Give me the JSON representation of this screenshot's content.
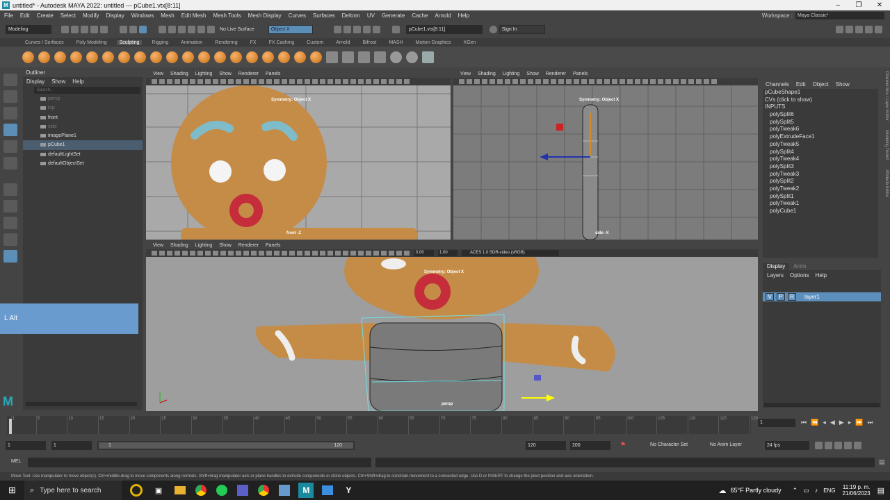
{
  "window": {
    "title": "untitled* - Autodesk MAYA 2022: untitled   ---   pCube1.vtx[8:11]"
  },
  "menu": [
    "File",
    "Edit",
    "Create",
    "Select",
    "Modify",
    "Display",
    "Windows",
    "Mesh",
    "Edit Mesh",
    "Mesh Tools",
    "Mesh Display",
    "Curves",
    "Surfaces",
    "Deform",
    "UV",
    "Generate",
    "Cache",
    "Arnold",
    "Help"
  ],
  "workspace": {
    "label": "Workspace :",
    "value": "Maya Classic*"
  },
  "status": {
    "mode": "Modeling",
    "live": "No Live Surface",
    "symmetry": "Object X",
    "selection": "pCube1.vtx[8:11]",
    "signin": "Sign In"
  },
  "shelf_tabs": [
    "Curves / Surfaces",
    "Poly Modeling",
    "Sculpting",
    "Rigging",
    "Animation",
    "Rendering",
    "FX",
    "FX Caching",
    "Custom",
    "Arnold",
    "Bifrost",
    "MASH",
    "Motion Graphics",
    "XGen"
  ],
  "shelf_active": "Sculpting",
  "outliner": {
    "title": "Outliner",
    "menu": [
      "Display",
      "Show",
      "Help"
    ],
    "search": "Search...",
    "items": [
      "persp",
      "top",
      "front",
      "side",
      "imagePlane1",
      "pCube1",
      "defaultLightSet",
      "defaultObjectSet"
    ]
  },
  "viewports": {
    "menu": [
      "View",
      "Shading",
      "Lighting",
      "Show",
      "Renderer",
      "Panels"
    ],
    "front_hud": "Symmetry: Object X",
    "front_label": "front -Z",
    "side_hud": "Symmetry: Object X",
    "side_label": "side -X",
    "persp_hud": "Symmetry: Object X",
    "persp_label": "persp",
    "exposure": "0.00",
    "gamma": "1.00",
    "colorspace": "ACES 1.0 SDR-video (sRGB)"
  },
  "channelbox": {
    "menu": [
      "Channels",
      "Edit",
      "Object",
      "Show"
    ],
    "shape": "pCubeShape1",
    "cvs": "CVs (click to show)",
    "inputs": "INPUTS",
    "history": [
      "polySplit6",
      "polySplit5",
      "polyTweak6",
      "polyExtrudeFace1",
      "polyTweak5",
      "polySplit4",
      "polyTweak4",
      "polySplit3",
      "polyTweak3",
      "polySplit2",
      "polyTweak2",
      "polySplit1",
      "polyTweak1",
      "polyCube1"
    ]
  },
  "layers": {
    "tabs": [
      "Display",
      "Anim"
    ],
    "menu": [
      "Layers",
      "Options",
      "Help"
    ],
    "layer": "layer1",
    "flags": [
      "V",
      "P",
      "R"
    ]
  },
  "side_tabs": [
    "Channel Box / Layer Editor",
    "Modeling Toolkit",
    "Attribute Editor"
  ],
  "timeline": {
    "ticks": [
      "1",
      "5",
      "10",
      "15",
      "20",
      "25",
      "30",
      "35",
      "40",
      "45",
      "50",
      "55",
      "60",
      "65",
      "70",
      "75",
      "80",
      "85",
      "90",
      "95",
      "100",
      "105",
      "110",
      "115",
      "120"
    ],
    "current": "1"
  },
  "range": {
    "start": "1",
    "start2": "1",
    "slider_start": "1",
    "slider_end": "120",
    "end": "120",
    "end2": "200",
    "charset": "No Character Set",
    "animlayer": "No Anim Layer",
    "fps": "24 fps"
  },
  "mel": {
    "label": "MEL"
  },
  "help": "Move Tool: Use manipulator to move object(s). Ctrl+middle-drag to move components along normals. Shift+drag manipulator axis or plane handles to extrude components or clone objects. Ctrl+Shift+drag to constrain movement to a connected edge. Use D or INSERT to change the pivot position and axis orientation.",
  "overlay": {
    "key": "L Alt"
  },
  "taskbar": {
    "search": "Type here to search",
    "weather": "65°F  Partly cloudy",
    "lang": "ENG",
    "time": "11:19 p. m.",
    "date": "21/06/2023"
  }
}
